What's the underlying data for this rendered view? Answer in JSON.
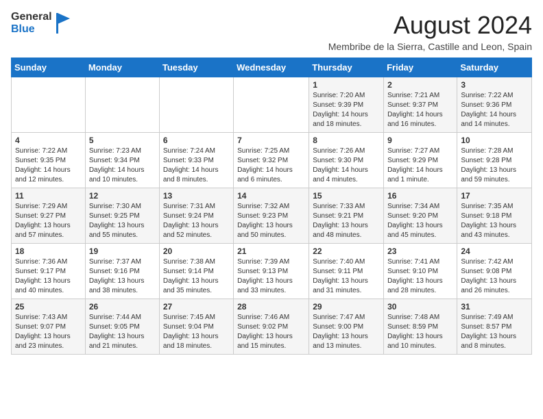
{
  "logo": {
    "line1": "General",
    "line2": "Blue"
  },
  "title": "August 2024",
  "subtitle": "Membribe de la Sierra, Castille and Leon, Spain",
  "days_of_week": [
    "Sunday",
    "Monday",
    "Tuesday",
    "Wednesday",
    "Thursday",
    "Friday",
    "Saturday"
  ],
  "weeks": [
    [
      {
        "day": "",
        "info": ""
      },
      {
        "day": "",
        "info": ""
      },
      {
        "day": "",
        "info": ""
      },
      {
        "day": "",
        "info": ""
      },
      {
        "day": "1",
        "info": "Sunrise: 7:20 AM\nSunset: 9:39 PM\nDaylight: 14 hours and 18 minutes."
      },
      {
        "day": "2",
        "info": "Sunrise: 7:21 AM\nSunset: 9:37 PM\nDaylight: 14 hours and 16 minutes."
      },
      {
        "day": "3",
        "info": "Sunrise: 7:22 AM\nSunset: 9:36 PM\nDaylight: 14 hours and 14 minutes."
      }
    ],
    [
      {
        "day": "4",
        "info": "Sunrise: 7:22 AM\nSunset: 9:35 PM\nDaylight: 14 hours and 12 minutes."
      },
      {
        "day": "5",
        "info": "Sunrise: 7:23 AM\nSunset: 9:34 PM\nDaylight: 14 hours and 10 minutes."
      },
      {
        "day": "6",
        "info": "Sunrise: 7:24 AM\nSunset: 9:33 PM\nDaylight: 14 hours and 8 minutes."
      },
      {
        "day": "7",
        "info": "Sunrise: 7:25 AM\nSunset: 9:32 PM\nDaylight: 14 hours and 6 minutes."
      },
      {
        "day": "8",
        "info": "Sunrise: 7:26 AM\nSunset: 9:30 PM\nDaylight: 14 hours and 4 minutes."
      },
      {
        "day": "9",
        "info": "Sunrise: 7:27 AM\nSunset: 9:29 PM\nDaylight: 14 hours and 1 minute."
      },
      {
        "day": "10",
        "info": "Sunrise: 7:28 AM\nSunset: 9:28 PM\nDaylight: 13 hours and 59 minutes."
      }
    ],
    [
      {
        "day": "11",
        "info": "Sunrise: 7:29 AM\nSunset: 9:27 PM\nDaylight: 13 hours and 57 minutes."
      },
      {
        "day": "12",
        "info": "Sunrise: 7:30 AM\nSunset: 9:25 PM\nDaylight: 13 hours and 55 minutes."
      },
      {
        "day": "13",
        "info": "Sunrise: 7:31 AM\nSunset: 9:24 PM\nDaylight: 13 hours and 52 minutes."
      },
      {
        "day": "14",
        "info": "Sunrise: 7:32 AM\nSunset: 9:23 PM\nDaylight: 13 hours and 50 minutes."
      },
      {
        "day": "15",
        "info": "Sunrise: 7:33 AM\nSunset: 9:21 PM\nDaylight: 13 hours and 48 minutes."
      },
      {
        "day": "16",
        "info": "Sunrise: 7:34 AM\nSunset: 9:20 PM\nDaylight: 13 hours and 45 minutes."
      },
      {
        "day": "17",
        "info": "Sunrise: 7:35 AM\nSunset: 9:18 PM\nDaylight: 13 hours and 43 minutes."
      }
    ],
    [
      {
        "day": "18",
        "info": "Sunrise: 7:36 AM\nSunset: 9:17 PM\nDaylight: 13 hours and 40 minutes."
      },
      {
        "day": "19",
        "info": "Sunrise: 7:37 AM\nSunset: 9:16 PM\nDaylight: 13 hours and 38 minutes."
      },
      {
        "day": "20",
        "info": "Sunrise: 7:38 AM\nSunset: 9:14 PM\nDaylight: 13 hours and 35 minutes."
      },
      {
        "day": "21",
        "info": "Sunrise: 7:39 AM\nSunset: 9:13 PM\nDaylight: 13 hours and 33 minutes."
      },
      {
        "day": "22",
        "info": "Sunrise: 7:40 AM\nSunset: 9:11 PM\nDaylight: 13 hours and 31 minutes."
      },
      {
        "day": "23",
        "info": "Sunrise: 7:41 AM\nSunset: 9:10 PM\nDaylight: 13 hours and 28 minutes."
      },
      {
        "day": "24",
        "info": "Sunrise: 7:42 AM\nSunset: 9:08 PM\nDaylight: 13 hours and 26 minutes."
      }
    ],
    [
      {
        "day": "25",
        "info": "Sunrise: 7:43 AM\nSunset: 9:07 PM\nDaylight: 13 hours and 23 minutes."
      },
      {
        "day": "26",
        "info": "Sunrise: 7:44 AM\nSunset: 9:05 PM\nDaylight: 13 hours and 21 minutes."
      },
      {
        "day": "27",
        "info": "Sunrise: 7:45 AM\nSunset: 9:04 PM\nDaylight: 13 hours and 18 minutes."
      },
      {
        "day": "28",
        "info": "Sunrise: 7:46 AM\nSunset: 9:02 PM\nDaylight: 13 hours and 15 minutes."
      },
      {
        "day": "29",
        "info": "Sunrise: 7:47 AM\nSunset: 9:00 PM\nDaylight: 13 hours and 13 minutes."
      },
      {
        "day": "30",
        "info": "Sunrise: 7:48 AM\nSunset: 8:59 PM\nDaylight: 13 hours and 10 minutes."
      },
      {
        "day": "31",
        "info": "Sunrise: 7:49 AM\nSunset: 8:57 PM\nDaylight: 13 hours and 8 minutes."
      }
    ]
  ]
}
